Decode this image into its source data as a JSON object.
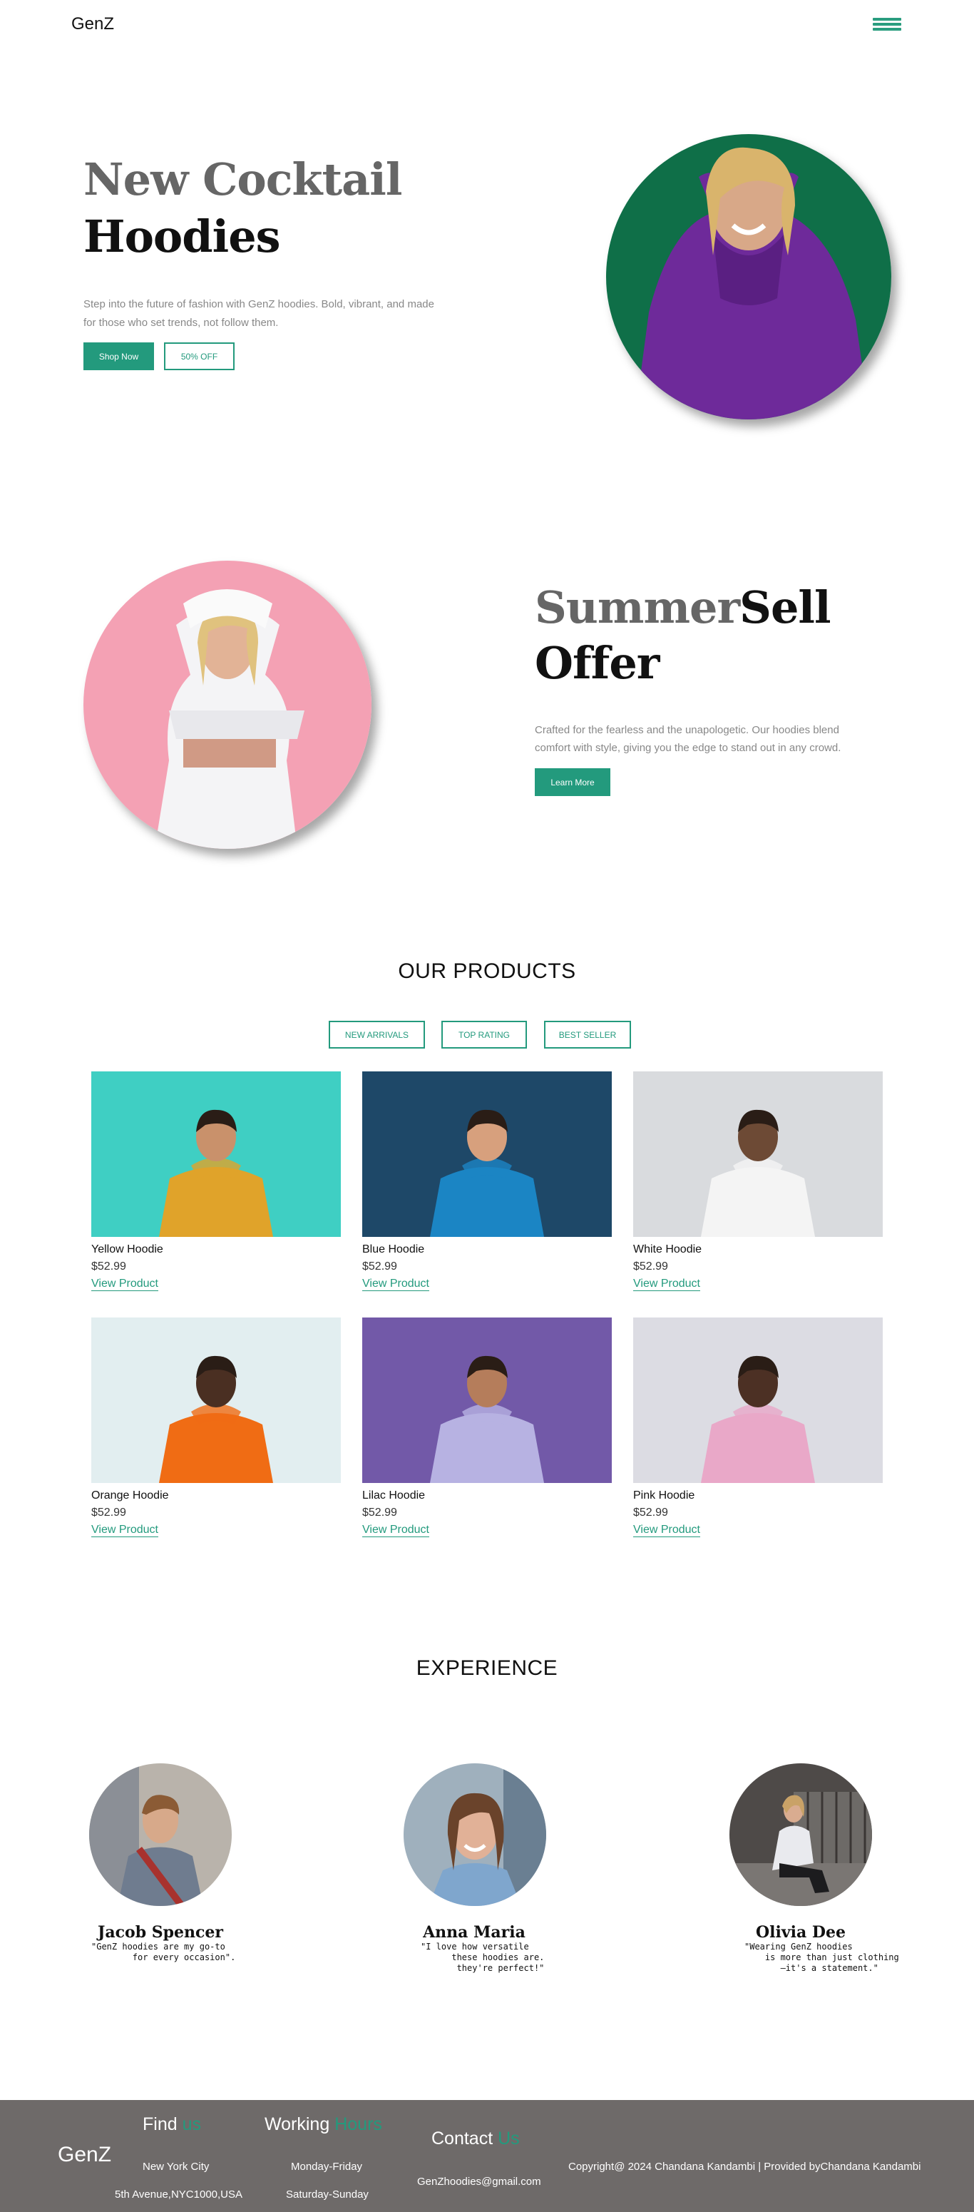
{
  "header": {
    "logo": "GenZ"
  },
  "hero": {
    "title_line1": "New Cocktail",
    "title_line2": "Hoodies",
    "description": "Step into the future of fashion with GenZ hoodies. Bold, vibrant, and made for those who set trends, not follow them.",
    "primary_button": "Shop Now",
    "secondary_button": "50% OFF"
  },
  "offer": {
    "title_part1": "Summer",
    "title_part2": "Sell",
    "title_line2": "Offer",
    "description": "Crafted for the fearless and the unapologetic. Our hoodies blend comfort with style, giving you the edge to stand out in any crowd.",
    "button": "Learn More"
  },
  "products": {
    "title": "OUR PRODUCTS",
    "tabs": [
      "NEW ARRIVALS",
      "TOP RATING",
      "BEST SELLER"
    ],
    "items": [
      {
        "name": "Yellow Hoodie",
        "price": "$52.99",
        "link": "View Product",
        "bg": "#3fcfc3",
        "hoodie": "#e0a32a",
        "skin": "#c9916b"
      },
      {
        "name": "Blue Hoodie",
        "price": "$52.99",
        "link": "View Product",
        "bg": "#1e4868",
        "hoodie": "#1b85c4",
        "skin": "#d7a07d"
      },
      {
        "name": "White Hoodie",
        "price": "$52.99",
        "link": "View Product",
        "bg": "#d9dbde",
        "hoodie": "#f4f4f4",
        "skin": "#6d4a35"
      },
      {
        "name": "Orange Hoodie",
        "price": "$52.99",
        "link": "View Product",
        "bg": "#e2eef0",
        "hoodie": "#f06c14",
        "skin": "#4a2f22"
      },
      {
        "name": "Lilac Hoodie",
        "price": "$52.99",
        "link": "View Product",
        "bg": "#7259a8",
        "hoodie": "#b7b2e2",
        "skin": "#b57d5b"
      },
      {
        "name": "Pink Hoodie",
        "price": "$52.99",
        "link": "View Product",
        "bg": "#dcdce3",
        "hoodie": "#e9a8c8",
        "skin": "#4c3024"
      }
    ]
  },
  "experience": {
    "title": "EXPERIENCE",
    "testimonials": [
      {
        "name": "Jacob Spencer",
        "quote": "\"GenZ hoodies are my go-to\n        for every occasion\"."
      },
      {
        "name": "Anna Maria",
        "quote": "\"I love how versatile\n      these hoodies are.\n       they're perfect!\""
      },
      {
        "name": "Olivia Dee",
        "quote": "\"Wearing GenZ hoodies\n    is more than just clothing\n       —it's a statement.\""
      }
    ]
  },
  "footer": {
    "logo": "GenZ",
    "find": {
      "title": "Find",
      "accent": "us",
      "line1": "New York City",
      "line2": "5th Avenue,NYC1000,USA"
    },
    "working": {
      "title": "Working",
      "accent": "Hours",
      "line1": "Monday-Friday",
      "line2": "Saturday-Sunday"
    },
    "contact": {
      "title": "Contact",
      "accent": "Us",
      "email": "GenZhoodies@gmail.com"
    },
    "copyright": "Copyright@ 2024 Chandana Kandambi | Provided byChandana Kandambi"
  },
  "colors": {
    "accent": "#239a7d",
    "footer_bg": "#6e6a69"
  }
}
